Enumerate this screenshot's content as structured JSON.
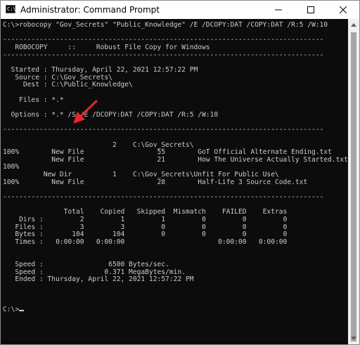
{
  "window": {
    "title": "Administrator: Command Prompt",
    "icon_text": "C:\\"
  },
  "title_buttons": {
    "minimize_icon": "minimize-icon",
    "maximize_icon": "maximize-icon",
    "close_icon": "close-icon"
  },
  "console": {
    "lines": [
      "C:\\>robocopy \"Gov_Secrets\" \"Public_Knowledge\" /E /DCOPY:DAT /COPY:DAT /R:5 /W:10",
      "",
      "-------------------------------------------------------------------------------",
      "   ROBOCOPY     ::     Robust File Copy for Windows",
      "-------------------------------------------------------------------------------",
      "",
      "  Started : Thursday, April 22, 2021 12:57:22 PM",
      "   Source : C:\\Gov_Secrets\\",
      "     Dest : C:\\Public_Knowledge\\",
      "",
      "    Files : *.*",
      "",
      "  Options : *.* /S /E /DCOPY:DAT /COPY:DAT /R:5 /W:10",
      "",
      "-------------------------------------------------------------------------------",
      "",
      "                           2    C:\\Gov_Secrets\\",
      "100%        New File                  55        GoT Official Alternate Ending.txt",
      "            New File                  21        How The Universe Actually Started.txt",
      "100%",
      "          New Dir          1    C:\\Gov_Secrets\\Unfit For Public Use\\",
      "100%        New File                  28        Half-Life 3 Source Code.txt",
      "",
      "-------------------------------------------------------------------------------",
      "",
      "               Total    Copied   Skipped  Mismatch    FAILED    Extras",
      "    Dirs :         2         1         1         0         0         0",
      "   Files :         3         3         0         0         0         0",
      "   Bytes :       104       104         0         0         0         0",
      "   Times :   0:00:00   0:00:00                       0:00:00   0:00:00",
      "",
      "",
      "   Speed :                6500 Bytes/sec.",
      "   Speed :               0.371 MegaBytes/min.",
      "   Ended : Thursday, April 22, 2021 12:57:22 PM",
      "",
      "",
      ""
    ],
    "prompt": "C:\\>"
  },
  "annotation": {
    "arrow_color": "#e8262a",
    "arrow_icon": "red-arrow-icon"
  },
  "scrollbar": {
    "up_icon": "scroll-up-icon",
    "down_icon": "scroll-down-icon"
  }
}
